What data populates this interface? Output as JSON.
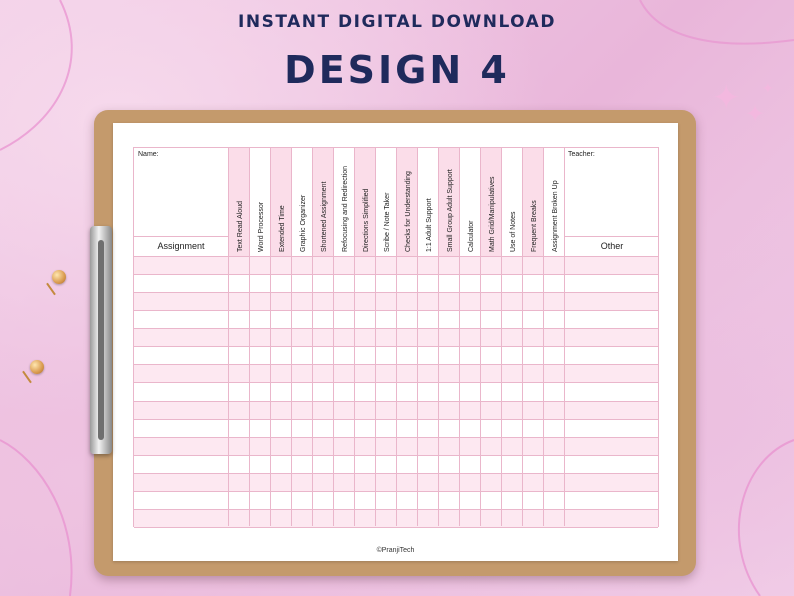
{
  "header": {
    "subtitle": "INSTANT DIGITAL DOWNLOAD",
    "title": "DESIGN 4"
  },
  "worksheet": {
    "name_label": "Name:",
    "teacher_label": "Teacher:",
    "assignment_label": "Assignment",
    "other_label": "Other",
    "columns": [
      "Text Read Aloud",
      "Word Processor",
      "Extended Time",
      "Graphic Organizer",
      "Shortened Assignment",
      "Refocusing and Redirection",
      "Directions Simplified",
      "Scribe / Note Taker",
      "Checks for Understanding",
      "1:1 Adult Support",
      "Small Group Adult Support",
      "Calculator",
      "Math Grid/Manipulatives",
      "Use of Notes",
      "Frequent Breaks",
      "Assignment Broken Up"
    ],
    "row_count": 15,
    "credit": "©PranjiTech"
  },
  "colors": {
    "title": "#1f2a5c",
    "grid_line": "#eab6cb",
    "pink_column": "#fbdde9",
    "row_band": "#fde8f1"
  },
  "decor": {
    "clip_icon": "clipboard-clip-icon",
    "pin_icon": "push-pin-icon",
    "sparkle_icon": "sparkle-icon"
  }
}
